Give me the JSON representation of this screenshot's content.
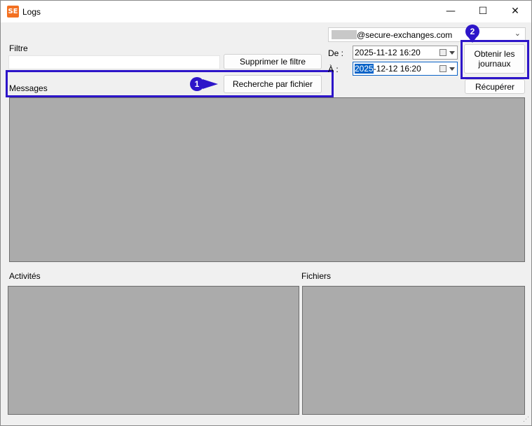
{
  "window": {
    "title": "Logs",
    "app_icon_text": "SE",
    "minimize_glyph": "—",
    "maximize_glyph": "☐",
    "close_glyph": "✕"
  },
  "filter": {
    "label": "Filtre",
    "value": "",
    "clear_button": "Supprimer le filtre"
  },
  "messages": {
    "label": "Messages",
    "search_by_file_button": "Recherche par fichier"
  },
  "account": {
    "email_domain": "@secure-exchanges.com"
  },
  "dates": {
    "from_label": "De :",
    "from_value": "2025-11-12 16:20",
    "to_label": "À :",
    "to_value_selected": "2025",
    "to_value_rest": "-12-12 16:20"
  },
  "buttons": {
    "get_logs": "Obtenir les journaux",
    "retrieve": "Récupérer"
  },
  "sections": {
    "activities_label": "Activités",
    "files_label": "Fichiers"
  },
  "callouts": {
    "first": "1",
    "second": "2"
  },
  "colors": {
    "highlight": "#2d15c9",
    "panel": "#ababab",
    "selection": "#0a64c8"
  }
}
